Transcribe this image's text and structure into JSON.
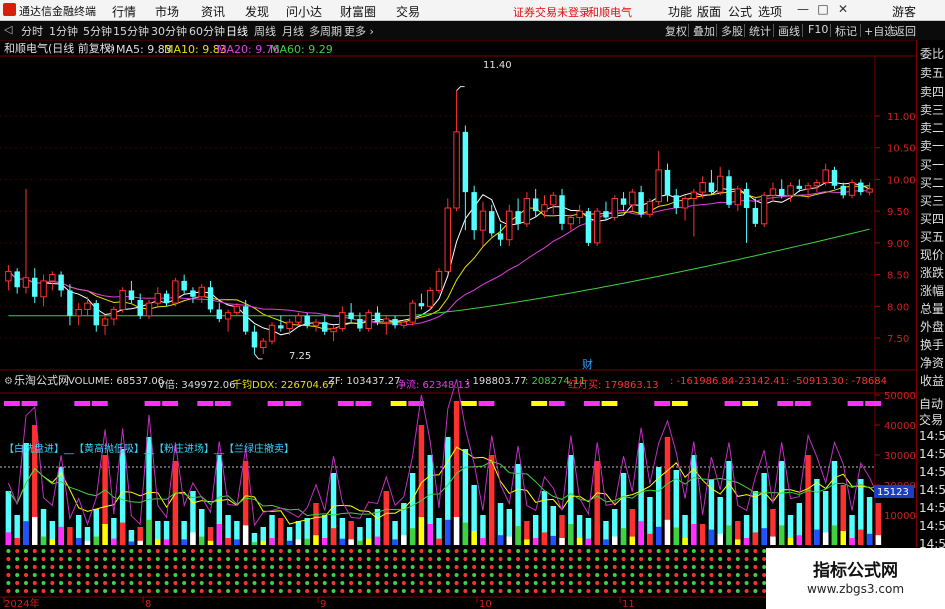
{
  "menubar": {
    "app_title": "通达信金融终端",
    "menus": [
      "行情",
      "市场",
      "资讯",
      "发现",
      "问小达",
      "财富圈",
      "交易"
    ],
    "alert": "证券交易未登录",
    "stock_tag": "和顺电气",
    "right_menus": [
      "功能",
      "版面",
      "公式",
      "选项"
    ],
    "window_buttons": [
      "—",
      "□",
      "✕"
    ],
    "guest": "游客"
  },
  "periodbar": {
    "arrow": "◁",
    "periods": [
      "分时",
      "1分钟",
      "5分钟",
      "15分钟",
      "30分钟",
      "60分钟",
      "日线",
      "周线",
      "月线",
      "多周期",
      "更多 ›"
    ],
    "active_index": 6,
    "tools": [
      "复权",
      "叠加",
      "多股",
      "统计",
      "画线",
      "F10",
      "标记",
      "+自选",
      "返回"
    ]
  },
  "kline": {
    "title": "和顺电气(日线 前复权)",
    "settings_icon": "gear-icon",
    "ma": [
      {
        "label": "MA5: 9.83",
        "color": "#ffffff"
      },
      {
        "label": "MA10: 9.83",
        "color": "#e8e000"
      },
      {
        "label": "MA20: 9.76",
        "color": "#e040e0"
      },
      {
        "label": "MA60: 9.29",
        "color": "#40d040"
      }
    ],
    "price_axis": [
      "11.00",
      "10.50",
      "10.00",
      "9.50",
      "9.00",
      "8.50",
      "8.00",
      "7.50"
    ],
    "high_label": "11.40",
    "low_label": "7.25",
    "finance_marker": "财",
    "ohlc": [
      [
        8.4,
        8.65,
        8.25,
        8.55
      ],
      [
        8.55,
        8.6,
        8.2,
        8.3
      ],
      [
        8.3,
        9.85,
        8.2,
        8.45
      ],
      [
        8.45,
        8.6,
        8.05,
        8.15
      ],
      [
        8.15,
        8.5,
        8.0,
        8.4
      ],
      [
        8.4,
        8.55,
        8.25,
        8.5
      ],
      [
        8.5,
        8.55,
        8.15,
        8.25
      ],
      [
        8.25,
        8.35,
        7.7,
        7.85
      ],
      [
        7.85,
        8.05,
        7.7,
        7.95
      ],
      [
        7.95,
        8.15,
        7.85,
        8.05
      ],
      [
        8.05,
        8.1,
        7.6,
        7.7
      ],
      [
        7.7,
        7.85,
        7.55,
        7.8
      ],
      [
        7.8,
        8.0,
        7.7,
        7.95
      ],
      [
        7.95,
        8.3,
        7.9,
        8.25
      ],
      [
        8.25,
        8.4,
        8.05,
        8.1
      ],
      [
        8.1,
        8.2,
        7.8,
        7.85
      ],
      [
        7.85,
        8.1,
        7.8,
        8.05
      ],
      [
        8.05,
        8.3,
        8.0,
        8.2
      ],
      [
        8.2,
        8.25,
        8.0,
        8.05
      ],
      [
        8.05,
        8.45,
        8.0,
        8.4
      ],
      [
        8.4,
        8.5,
        8.2,
        8.25
      ],
      [
        8.25,
        8.3,
        8.05,
        8.15
      ],
      [
        8.15,
        8.35,
        8.05,
        8.3
      ],
      [
        8.3,
        8.4,
        7.9,
        7.95
      ],
      [
        7.95,
        8.05,
        7.75,
        7.8
      ],
      [
        7.8,
        7.95,
        7.6,
        7.9
      ],
      [
        7.9,
        8.05,
        7.85,
        8.0
      ],
      [
        8.0,
        8.1,
        7.55,
        7.6
      ],
      [
        7.6,
        7.7,
        7.25,
        7.35
      ],
      [
        7.35,
        7.5,
        7.25,
        7.45
      ],
      [
        7.45,
        7.75,
        7.4,
        7.7
      ],
      [
        7.7,
        7.85,
        7.6,
        7.65
      ],
      [
        7.65,
        7.8,
        7.55,
        7.75
      ],
      [
        7.75,
        7.9,
        7.7,
        7.85
      ],
      [
        7.85,
        7.9,
        7.65,
        7.7
      ],
      [
        7.7,
        7.8,
        7.6,
        7.75
      ],
      [
        7.75,
        7.85,
        7.55,
        7.6
      ],
      [
        7.6,
        7.7,
        7.45,
        7.65
      ],
      [
        7.65,
        8.0,
        7.6,
        7.9
      ],
      [
        7.9,
        8.05,
        7.75,
        7.8
      ],
      [
        7.8,
        7.9,
        7.6,
        7.65
      ],
      [
        7.65,
        7.95,
        7.6,
        7.9
      ],
      [
        7.9,
        8.0,
        7.7,
        7.75
      ],
      [
        7.75,
        7.85,
        7.55,
        7.8
      ],
      [
        7.8,
        7.85,
        7.65,
        7.7
      ],
      [
        7.7,
        7.8,
        7.65,
        7.75
      ],
      [
        7.75,
        8.1,
        7.7,
        8.05
      ],
      [
        8.05,
        8.2,
        7.95,
        8.0
      ],
      [
        8.0,
        8.3,
        7.95,
        8.25
      ],
      [
        8.25,
        8.6,
        8.2,
        8.55
      ],
      [
        8.55,
        9.7,
        8.5,
        9.55
      ],
      [
        9.55,
        11.4,
        9.5,
        10.75
      ],
      [
        10.75,
        10.85,
        9.2,
        9.8
      ],
      [
        9.8,
        9.9,
        9.05,
        9.2
      ],
      [
        9.2,
        9.65,
        8.95,
        9.5
      ],
      [
        9.5,
        9.6,
        9.1,
        9.15
      ],
      [
        9.15,
        9.3,
        8.95,
        9.05
      ],
      [
        9.05,
        9.6,
        8.95,
        9.5
      ],
      [
        9.5,
        9.7,
        9.2,
        9.3
      ],
      [
        9.3,
        9.8,
        9.25,
        9.7
      ],
      [
        9.7,
        9.85,
        9.4,
        9.5
      ],
      [
        9.5,
        9.75,
        9.4,
        9.6
      ],
      [
        9.6,
        9.8,
        9.45,
        9.75
      ],
      [
        9.75,
        9.85,
        9.2,
        9.3
      ],
      [
        9.3,
        9.45,
        9.2,
        9.4
      ],
      [
        9.4,
        9.6,
        9.3,
        9.5
      ],
      [
        9.5,
        9.55,
        8.95,
        9.0
      ],
      [
        9.0,
        9.55,
        8.95,
        9.5
      ],
      [
        9.5,
        9.65,
        9.35,
        9.4
      ],
      [
        9.4,
        9.75,
        9.35,
        9.7
      ],
      [
        9.7,
        9.8,
        9.5,
        9.6
      ],
      [
        9.6,
        9.85,
        9.5,
        9.8
      ],
      [
        9.8,
        9.9,
        9.4,
        9.45
      ],
      [
        9.45,
        9.7,
        9.4,
        9.65
      ],
      [
        9.65,
        10.45,
        9.6,
        10.15
      ],
      [
        10.15,
        10.25,
        9.65,
        9.75
      ],
      [
        9.75,
        9.85,
        9.45,
        9.55
      ],
      [
        9.55,
        9.75,
        9.35,
        9.7
      ],
      [
        9.7,
        9.85,
        9.1,
        9.8
      ],
      [
        9.8,
        10.05,
        9.7,
        9.95
      ],
      [
        9.95,
        10.15,
        9.75,
        9.8
      ],
      [
        9.8,
        10.2,
        9.75,
        10.05
      ],
      [
        10.05,
        10.15,
        9.55,
        9.6
      ],
      [
        9.6,
        9.9,
        9.5,
        9.85
      ],
      [
        9.85,
        9.95,
        9.0,
        9.55
      ],
      [
        9.55,
        9.7,
        9.25,
        9.3
      ],
      [
        9.3,
        9.8,
        9.25,
        9.75
      ],
      [
        9.75,
        9.95,
        9.65,
        9.85
      ],
      [
        9.85,
        10.0,
        9.7,
        9.75
      ],
      [
        9.75,
        9.95,
        9.65,
        9.9
      ],
      [
        9.9,
        10.0,
        9.8,
        9.85
      ],
      [
        9.85,
        9.95,
        9.7,
        9.9
      ],
      [
        9.9,
        10.0,
        9.8,
        9.95
      ],
      [
        9.95,
        10.25,
        9.9,
        10.15
      ],
      [
        10.15,
        10.2,
        9.85,
        9.9
      ],
      [
        9.9,
        9.95,
        9.7,
        9.75
      ],
      [
        9.75,
        10.0,
        9.7,
        9.95
      ],
      [
        9.95,
        10.0,
        9.75,
        9.8
      ],
      [
        9.8,
        9.95,
        9.75,
        9.85
      ]
    ]
  },
  "indicator": {
    "name": "乐淘公式网",
    "settings_icon": "gear-icon",
    "values": [
      {
        "text": "VOLUME: 68537.06",
        "color": "#ffffff"
      },
      {
        "text": "V倍: 349972.06",
        "color": "#ffffff"
      },
      {
        "text": "千钧DDX: 226704.67",
        "color": "#e8e000"
      },
      {
        "text": "ZF: 103437.27",
        "color": "#ffffff"
      },
      {
        "text": "净流: 62348.13",
        "color": "#e040e0"
      },
      {
        "text": ": 198803.77",
        "color": "#ffffff"
      },
      {
        "text": ": 208274.11",
        "color": "#40d040"
      },
      {
        "text": "红灯买: 179863.13",
        "color": "#ff3030"
      },
      {
        "text": ": -161986.84",
        "color": "#ff3030"
      },
      {
        "text": ": -23142.41",
        "color": "#ff3030"
      },
      {
        "text": ": -50913.30",
        "color": "#ff3030"
      },
      {
        "text": ": -78684",
        "color": "#ff3030"
      }
    ],
    "legend_text": "【白洗盘进】__【黄高抛低吸】__【粉庄进场】__【兰绿庄撤卖】",
    "axis": [
      "50000",
      "40000",
      "30000",
      "20000",
      "10000"
    ],
    "current_value": "15123",
    "volume": [
      18,
      10,
      34,
      40,
      12,
      8,
      26,
      6,
      10,
      6,
      12,
      30,
      9,
      32,
      5,
      6,
      36,
      8,
      8,
      28,
      8,
      18,
      12,
      6,
      30,
      10,
      8,
      28,
      4,
      6,
      10,
      9,
      6,
      8,
      9,
      14,
      10,
      24,
      9,
      8,
      6,
      9,
      12,
      18,
      8,
      14,
      24,
      40,
      30,
      9,
      36,
      48,
      32,
      20,
      10,
      30,
      14,
      12,
      27,
      8,
      10,
      18,
      13,
      10,
      30,
      10,
      9,
      28,
      8,
      12,
      24,
      12,
      34,
      16,
      26,
      36,
      25,
      10,
      30,
      7,
      22,
      16,
      28,
      8,
      10,
      18,
      24,
      12,
      28,
      10,
      14,
      30,
      22,
      18,
      28,
      20,
      10,
      22,
      16,
      14
    ]
  },
  "date_axis": [
    "2024年",
    "8",
    "9",
    "10",
    "11"
  ],
  "right_panel": {
    "items": [
      "委比",
      "卖五",
      "卖四",
      "卖三",
      "卖二",
      "卖一",
      "买一",
      "买二",
      "买三",
      "买四",
      "买五",
      "现价",
      "涨跌",
      "涨幅",
      "总量",
      "外盘",
      "换手",
      "净资",
      "收益"
    ],
    "sub_header_1": "自动",
    "sub_header_2": "交易",
    "times": [
      "14:5",
      "14:5",
      "14:5",
      "14:5",
      "14:5",
      "14:5",
      "14:5"
    ]
  },
  "watermark": {
    "title": "指标公式网",
    "url": "www.zbgs3.com"
  }
}
